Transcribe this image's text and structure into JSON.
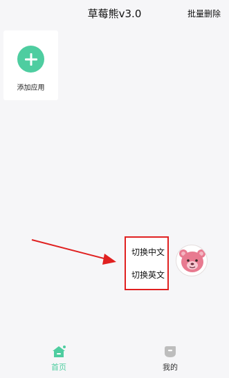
{
  "header": {
    "title": "草莓熊v3.0",
    "batch_delete": "批量删除"
  },
  "apps": {
    "add_label": "添加应用"
  },
  "language_menu": {
    "chinese": "切换中文",
    "english": "切换英文"
  },
  "tabbar": {
    "home": {
      "label": "首页",
      "icon": "home-icon"
    },
    "mine": {
      "label": "我的",
      "icon": "profile-icon"
    }
  },
  "colors": {
    "accent": "#4ecda0",
    "highlight": "#e02020"
  }
}
